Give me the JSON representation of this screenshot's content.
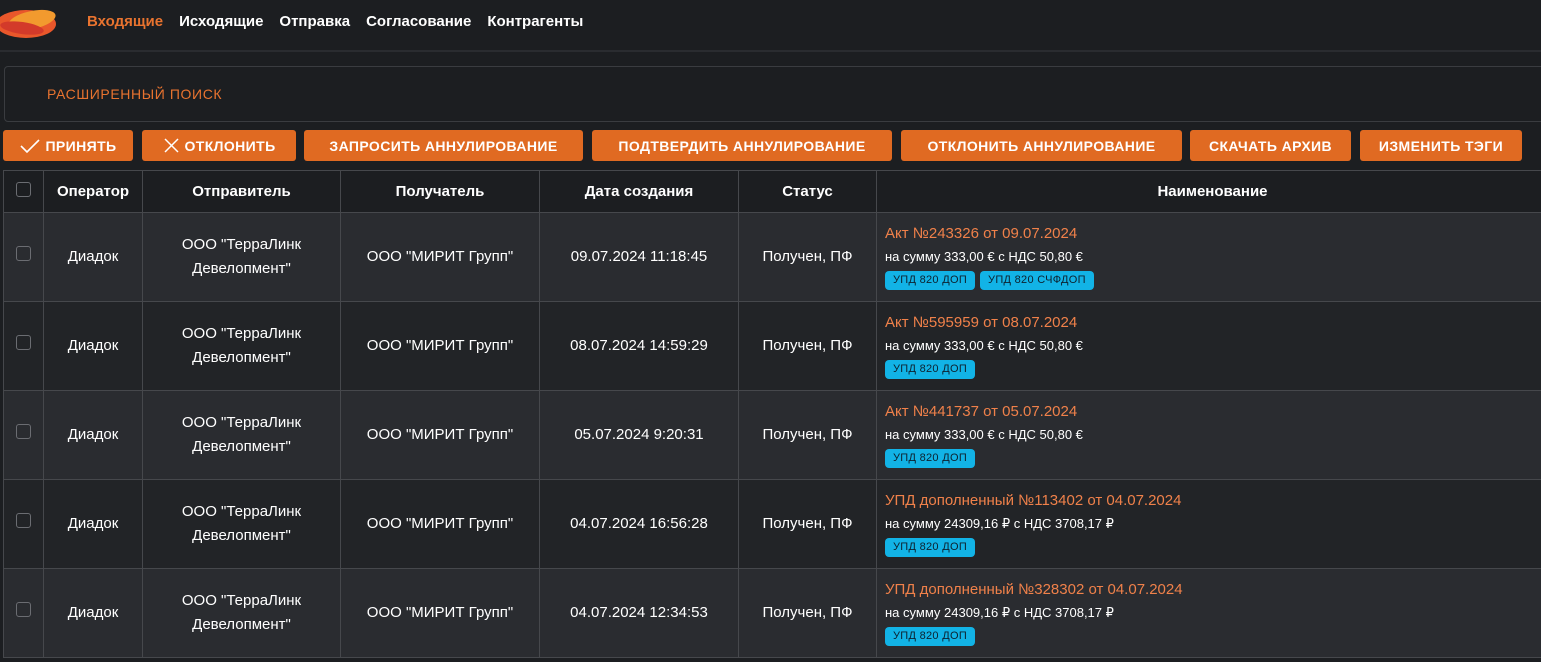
{
  "nav": {
    "items": [
      {
        "label": "Входящие",
        "active": true
      },
      {
        "label": "Исходящие",
        "active": false
      },
      {
        "label": "Отправка",
        "active": false
      },
      {
        "label": "Согласование",
        "active": false
      },
      {
        "label": "Контрагенты",
        "active": false
      }
    ]
  },
  "search": {
    "label": "РАСШИРЕННЫЙ ПОИСК"
  },
  "actions": {
    "accept": "ПРИНЯТЬ",
    "reject": "ОТКЛОНИТЬ",
    "request_cancel": "ЗАПРОСИТЬ АННУЛИРОВАНИЕ",
    "confirm_cancel": "ПОДТВЕРДИТЬ АННУЛИРОВАНИЕ",
    "reject_cancel": "ОТКЛОНИТЬ АННУЛИРОВАНИЕ",
    "download_archive": "СКАЧАТЬ АРХИВ",
    "change_tags": "ИЗМЕНИТЬ ТЭГИ"
  },
  "table": {
    "headers": {
      "operator": "Оператор",
      "sender": "Отправитель",
      "recipient": "Получатель",
      "created": "Дата создания",
      "status": "Статус",
      "name": "Наименование"
    },
    "rows": [
      {
        "operator": "Диадок",
        "sender_line1": "ООО \"ТерраЛинк",
        "sender_line2": "Девелопмент\"",
        "recipient": "ООО \"МИРИТ Групп\"",
        "created": "09.07.2024 11:18:45",
        "status": "Получен, ПФ",
        "title": "Акт №243326 от 09.07.2024",
        "sum": "на сумму 333,00 € с НДС 50,80 €",
        "tags": [
          "УПД 820 ДОП",
          "УПД 820 СЧФДОП"
        ]
      },
      {
        "operator": "Диадок",
        "sender_line1": "ООО \"ТерраЛинк",
        "sender_line2": "Девелопмент\"",
        "recipient": "ООО \"МИРИТ Групп\"",
        "created": "08.07.2024 14:59:29",
        "status": "Получен, ПФ",
        "title": "Акт №595959 от 08.07.2024",
        "sum": "на сумму 333,00 € с НДС 50,80 €",
        "tags": [
          "УПД 820 ДОП"
        ]
      },
      {
        "operator": "Диадок",
        "sender_line1": "ООО \"ТерраЛинк",
        "sender_line2": "Девелопмент\"",
        "recipient": "ООО \"МИРИТ Групп\"",
        "created": "05.07.2024 9:20:31",
        "status": "Получен, ПФ",
        "title": "Акт №441737 от 05.07.2024",
        "sum": "на сумму 333,00 € с НДС 50,80 €",
        "tags": [
          "УПД 820 ДОП"
        ]
      },
      {
        "operator": "Диадок",
        "sender_line1": "ООО \"ТерраЛинк",
        "sender_line2": "Девелопмент\"",
        "recipient": "ООО \"МИРИТ Групп\"",
        "created": "04.07.2024 16:56:28",
        "status": "Получен, ПФ",
        "title": "УПД дополненный №113402 от 04.07.2024",
        "sum": "на сумму 24309,16 ₽ с НДС 3708,17 ₽",
        "tags": [
          "УПД 820 ДОП"
        ]
      },
      {
        "operator": "Диадок",
        "sender_line1": "ООО \"ТерраЛинк",
        "sender_line2": "Девелопмент\"",
        "recipient": "ООО \"МИРИТ Групп\"",
        "created": "04.07.2024 12:34:53",
        "status": "Получен, ПФ",
        "title": "УПД дополненный №328302 от 04.07.2024",
        "sum": "на сумму 24309,16 ₽ с НДС 3708,17 ₽",
        "tags": [
          "УПД 820 ДОП"
        ]
      }
    ]
  },
  "colors": {
    "accent": "#e06a22",
    "title_link": "#f0814a",
    "tag": "#12b3e6",
    "background": "#1c1e21"
  },
  "icons": {
    "logo": "brand-logo",
    "accept": "check-icon",
    "reject": "close-icon"
  }
}
